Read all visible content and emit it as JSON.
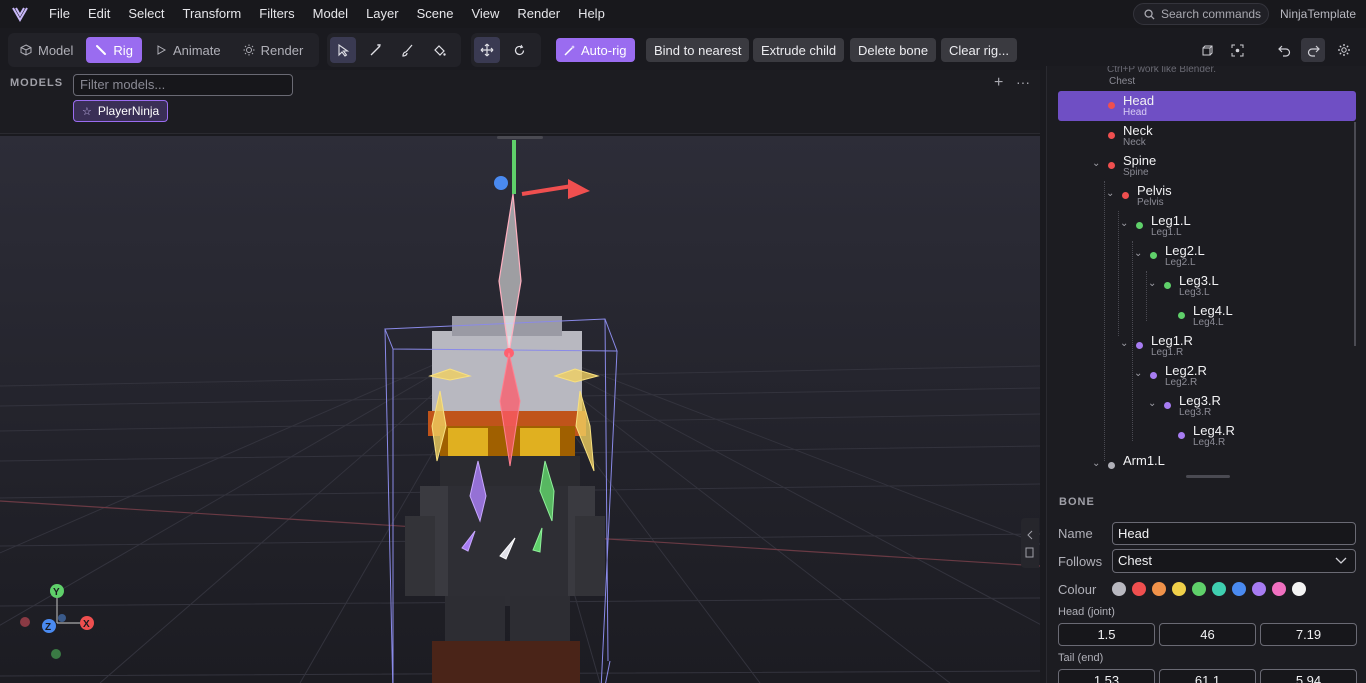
{
  "menubar": {
    "items": [
      "File",
      "Edit",
      "Select",
      "Transform",
      "Filters",
      "Model",
      "Layer",
      "Scene",
      "View",
      "Render",
      "Help"
    ],
    "search_placeholder": "Search commands",
    "project_name": "NinjaTemplate"
  },
  "toolbar": {
    "modes": [
      {
        "label": "Model",
        "icon": "cube-icon",
        "active": false
      },
      {
        "label": "Rig",
        "icon": "bone-icon",
        "active": true
      },
      {
        "label": "Animate",
        "icon": "play-icon",
        "active": false
      },
      {
        "label": "Render",
        "icon": "sun-icon",
        "active": false
      }
    ],
    "tools": [
      "select-pointer-icon",
      "bone-draw-icon",
      "paint-brush-icon",
      "paint-bucket-icon"
    ],
    "transform_tools": [
      "move-gizmo-icon",
      "rotate-icon"
    ],
    "rig_actions": {
      "auto_rig": "Auto-rig",
      "bind_to_nearest": "Bind to nearest",
      "extrude_child": "Extrude child",
      "delete_bone": "Delete bone",
      "clear_rig": "Clear rig..."
    },
    "right_icons": [
      "view-cube-icon",
      "frame-selection-icon",
      "undo-icon",
      "redo-icon",
      "settings-icon"
    ]
  },
  "models": {
    "label": "MODELS",
    "filter_placeholder": "Filter models...",
    "items": [
      {
        "name": "PlayerNinja",
        "starred": true
      }
    ],
    "add_icon": "plus-icon",
    "more_icon": "more-dots-icon"
  },
  "viewport": {
    "axis_labels": {
      "y": "Y",
      "x": "X",
      "z": "Z"
    },
    "accent": "#9a6cf0"
  },
  "bones": {
    "hint": "Ctrl+P work like Blender.",
    "items": [
      {
        "name": "Chest",
        "sub": "Chest",
        "color": null,
        "expand": false
      },
      {
        "name": "Head",
        "sub": "Head",
        "color": "#ef4f4f",
        "selected": true
      },
      {
        "name": "Neck",
        "sub": "Neck",
        "color": "#ef4f4f"
      },
      {
        "name": "Spine",
        "sub": "Spine",
        "color": "#ef4f4f"
      },
      {
        "name": "Pelvis",
        "sub": "Pelvis",
        "color": "#ef4f4f"
      },
      {
        "name": "Leg1.L",
        "sub": "Leg1.L",
        "color": "#5fd06a"
      },
      {
        "name": "Leg2.L",
        "sub": "Leg2.L",
        "color": "#5fd06a"
      },
      {
        "name": "Leg3.L",
        "sub": "Leg3.L",
        "color": "#5fd06a"
      },
      {
        "name": "Leg4.L",
        "sub": "Leg4.L",
        "color": "#5fd06a"
      },
      {
        "name": "Leg1.R",
        "sub": "Leg1.R",
        "color": "#a77cf2"
      },
      {
        "name": "Leg2.R",
        "sub": "Leg2.R",
        "color": "#a77cf2"
      },
      {
        "name": "Leg3.R",
        "sub": "Leg3.R",
        "color": "#a77cf2"
      },
      {
        "name": "Leg4.R",
        "sub": "Leg4.R",
        "color": "#a77cf2"
      },
      {
        "name": "Arm1.L",
        "sub": "",
        "color": "#b0b0b8"
      }
    ]
  },
  "bone_panel": {
    "title": "BONE",
    "name_label": "Name",
    "name_value": "Head",
    "follows_label": "Follows",
    "follows_value": "Chest",
    "colour_label": "Colour",
    "swatches": [
      "#b8b8c0",
      "#ef4f4f",
      "#f0924a",
      "#f0d04a",
      "#5fd06a",
      "#3fcfb0",
      "#4a8af0",
      "#a77cf2",
      "#f070c0",
      "#f4f4f4"
    ],
    "head_label": "Head (joint)",
    "head_values": [
      "1.5",
      "46",
      "7.19"
    ],
    "tail_label": "Tail (end)",
    "tail_values": [
      "1.53",
      "61.1",
      "5.94"
    ]
  }
}
